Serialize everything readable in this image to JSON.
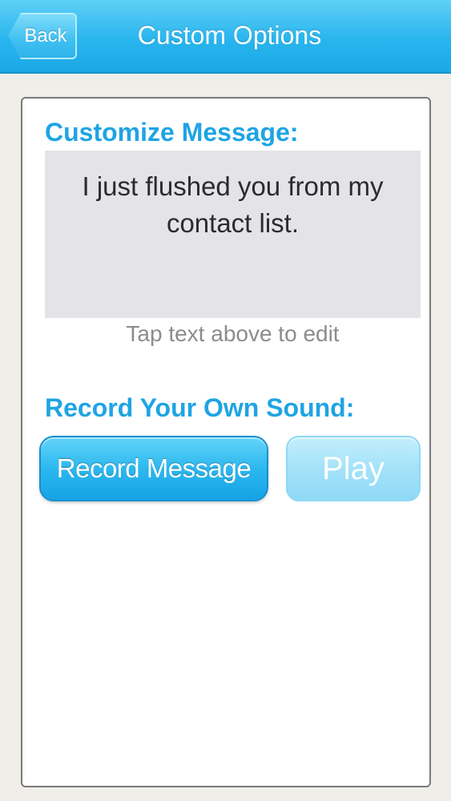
{
  "navbar": {
    "back_label": "Back",
    "title": "Custom Options"
  },
  "customize": {
    "heading": "Customize Message:",
    "message": "I just flushed you from my contact list.",
    "hint": "Tap text above to edit"
  },
  "record": {
    "heading": "Record Your Own Sound:",
    "record_label": "Record Message",
    "play_label": "Play"
  },
  "colors": {
    "accent": "#1fa4e3",
    "navbar": "#29b5ee",
    "play_disabled": "#a3e2f9",
    "message_bg": "#e4e3e8"
  }
}
